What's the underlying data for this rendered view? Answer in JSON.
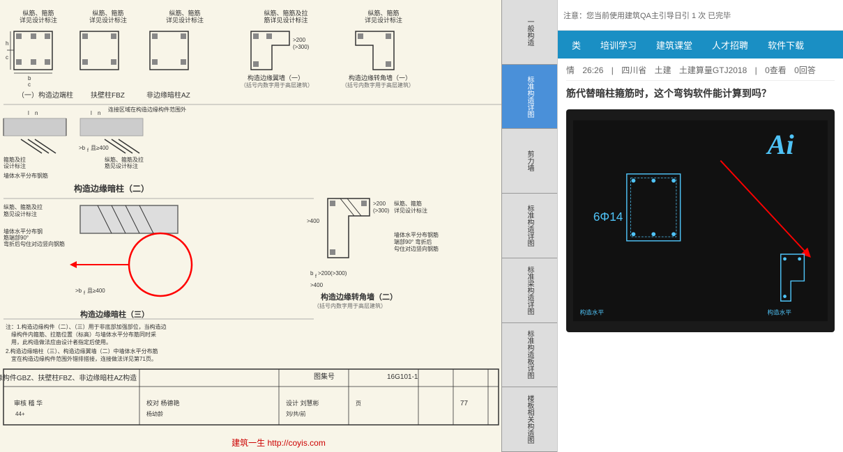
{
  "left_panel": {
    "watermark": "建筑一生 http://coyis.com",
    "index_items": [
      {
        "label": "标准构造详图",
        "active": false
      },
      {
        "label": "标准构造详图",
        "active": true
      },
      {
        "label": "剪力墙",
        "active": false
      },
      {
        "label": "标准构造详图",
        "active": false
      },
      {
        "label": "标准梁构造详图",
        "active": false
      },
      {
        "label": "标准构造板详图",
        "active": false
      },
      {
        "label": "楼板相关构造图",
        "active": false
      }
    ],
    "top_label": "一般构造",
    "drawing_title": "构造边缘构件GBZ、扶壁柱FBZ、非边缘暗柱AZ构造",
    "drawing_set": "图集号",
    "drawing_number": "16G101-1",
    "page": "77",
    "review": "审核 稽 华",
    "校对": "校对 杨德艳",
    "design": "设计 刘慧彬"
  },
  "right_panel": {
    "top_notice": "注意：您当前使用建筑QA主引导日引 1 次 已完毕",
    "nav_items": [
      {
        "label": "类",
        "key": "category"
      },
      {
        "label": "培训学习",
        "key": "training"
      },
      {
        "label": "建筑课堂",
        "key": "classroom"
      },
      {
        "label": "人才招聘",
        "key": "talent"
      },
      {
        "label": "软件下载",
        "key": "software"
      }
    ],
    "info": {
      "time": "26:26",
      "province": "四川省",
      "profession": "土建",
      "type": "土建算量GTJ2018",
      "views": "0查看",
      "answers": "0回答"
    },
    "question_title": "筋代替暗柱箍筋时，这个弯钩软件能计算到吗？",
    "ai_label": "Ai",
    "ai_answer_text": "6Φ14",
    "cad_labels": {
      "bottom_left": "构造水平",
      "bottom_right": "构造水平"
    }
  }
}
